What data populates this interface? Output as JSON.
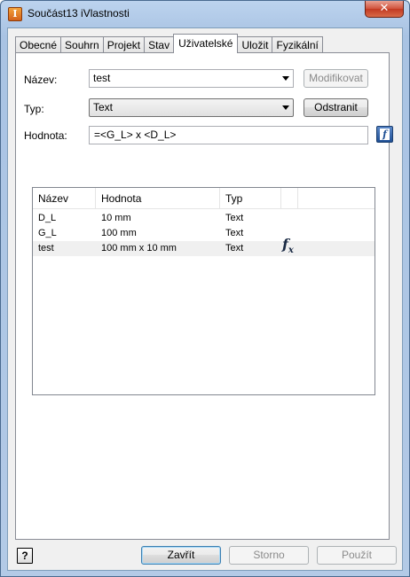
{
  "window": {
    "title": "Součást13 iVlastnosti",
    "app_icon_letter": "I",
    "close_glyph": "✕"
  },
  "tabs": [
    {
      "label": "Obecné",
      "active": false
    },
    {
      "label": "Souhrn",
      "active": false
    },
    {
      "label": "Projekt",
      "active": false
    },
    {
      "label": "Stav",
      "active": false
    },
    {
      "label": "Uživatelské",
      "active": true
    },
    {
      "label": "Uložit",
      "active": false
    },
    {
      "label": "Fyzikální",
      "active": false
    }
  ],
  "form": {
    "name_label": "Název:",
    "name_value": "test",
    "modify_button": "Modifikovat",
    "type_label": "Typ:",
    "type_value": "Text",
    "delete_button": "Odstranit",
    "value_label": "Hodnota:",
    "value_value": "=<G_L> x <D_L>"
  },
  "table": {
    "columns": [
      "Název",
      "Hodnota",
      "Typ"
    ],
    "rows": [
      {
        "name": "D_L",
        "value": "10 mm",
        "type": "Text"
      },
      {
        "name": "G_L",
        "value": "100 mm",
        "type": "Text"
      },
      {
        "name": "test",
        "value": "100 mm  x 10 mm",
        "type": "Text",
        "has_formula": true
      }
    ]
  },
  "footer": {
    "help_glyph": "?",
    "close_button": "Zavřít",
    "cancel_button": "Storno",
    "apply_button": "Použít"
  },
  "icons": {
    "formula": "fx-icon",
    "expression_editor": "fx-editor-icon"
  },
  "colors": {
    "title_bar": "#bcd3ee",
    "close_red": "#c23a22",
    "panel_bg": "#f0f0f0"
  }
}
